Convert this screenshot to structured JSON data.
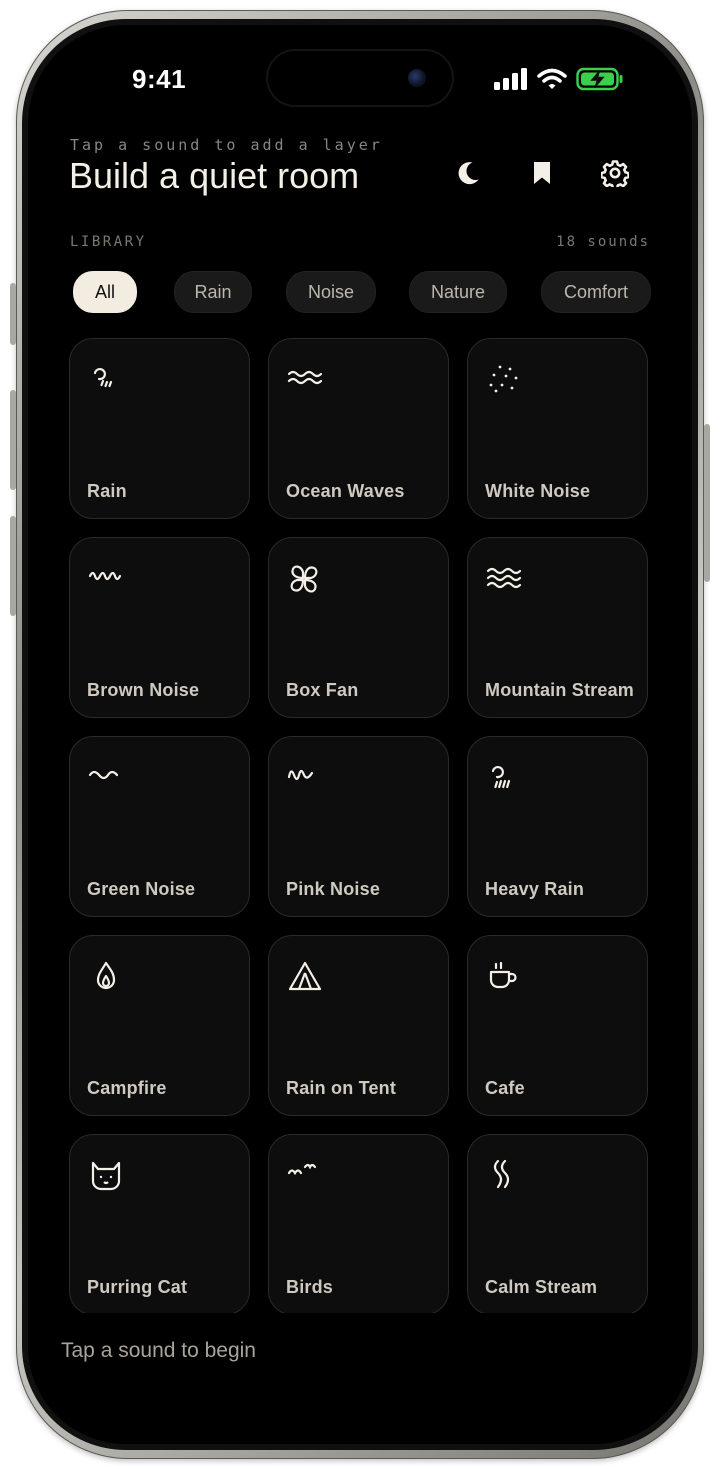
{
  "status_bar": {
    "time": "9:41",
    "icons": [
      "signal-icon",
      "wifi-icon",
      "battery-charging-icon"
    ]
  },
  "header": {
    "eyebrow": "Tap a sound to add a layer",
    "title": "Build a quiet room",
    "actions": [
      {
        "name": "moon-icon"
      },
      {
        "name": "bookmark-icon"
      },
      {
        "name": "gear-icon"
      }
    ]
  },
  "library": {
    "label": "LIBRARY",
    "count": "18 sounds"
  },
  "filters": {
    "selected": "All",
    "chips": [
      {
        "label": "All"
      },
      {
        "label": "Rain"
      },
      {
        "label": "Noise"
      },
      {
        "label": "Nature"
      },
      {
        "label": "Comfort"
      }
    ]
  },
  "sounds": [
    {
      "label": "Rain",
      "icon": "rain-drizzle-icon"
    },
    {
      "label": "Ocean Waves",
      "icon": "waves-icon"
    },
    {
      "label": "White Noise",
      "icon": "dots-noise-icon"
    },
    {
      "label": "Brown Noise",
      "icon": "squiggle-icon"
    },
    {
      "label": "Box Fan",
      "icon": "fan-icon"
    },
    {
      "label": "Mountain Stream",
      "icon": "stream-waves-icon"
    },
    {
      "label": "Green Noise",
      "icon": "tilde-icon"
    },
    {
      "label": "Pink Noise",
      "icon": "short-squiggle-icon"
    },
    {
      "label": "Heavy Rain",
      "icon": "heavy-rain-icon"
    },
    {
      "label": "Campfire",
      "icon": "flame-icon"
    },
    {
      "label": "Rain on Tent",
      "icon": "tent-icon"
    },
    {
      "label": "Cafe",
      "icon": "coffee-cup-icon"
    },
    {
      "label": "Purring Cat",
      "icon": "cat-icon"
    },
    {
      "label": "Birds",
      "icon": "birds-icon"
    },
    {
      "label": "Calm Stream",
      "icon": "s-waves-icon"
    }
  ],
  "footer": {
    "text": "Tap a sound to begin"
  },
  "colors": {
    "background": "#000000",
    "accent_chip": "#f3ece0",
    "tile": "#0d0d0d",
    "battery": "#3ccf4e"
  }
}
